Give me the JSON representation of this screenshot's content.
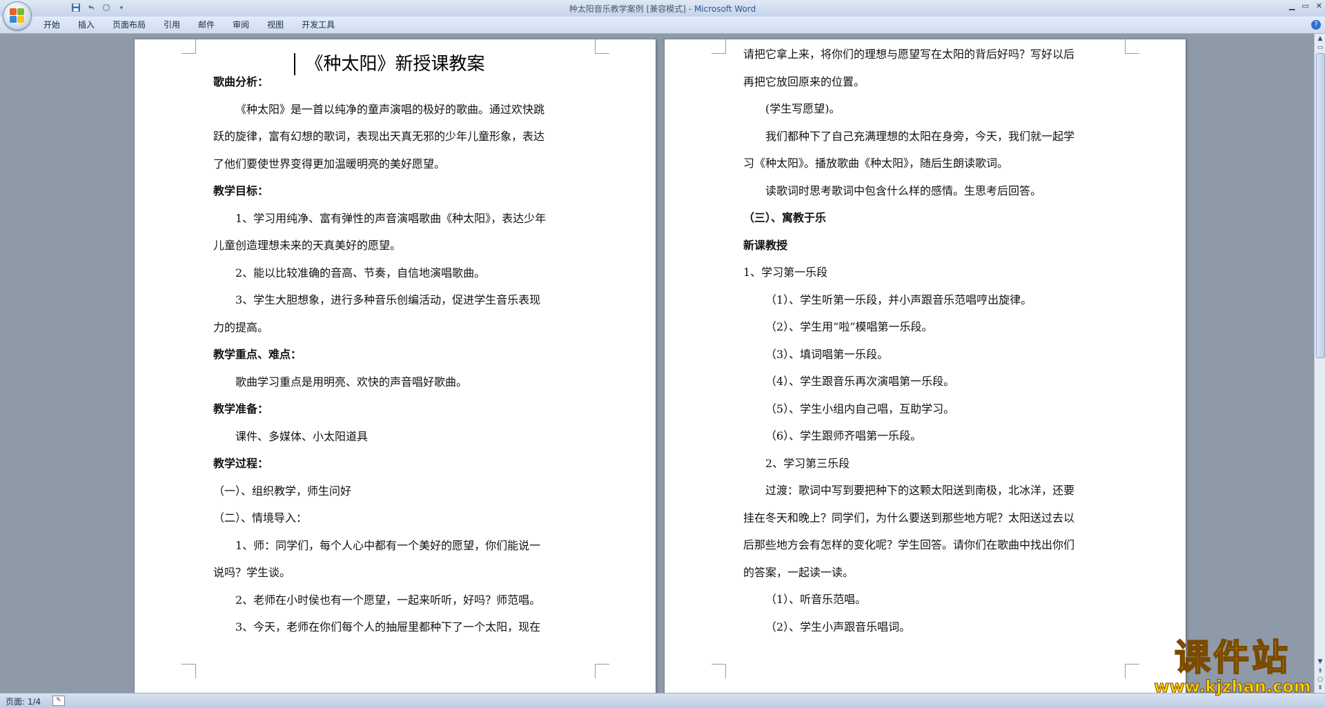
{
  "window": {
    "title": "种太阳音乐教学案例 [兼容模式]",
    "app_name": "Microsoft Word",
    "separator": " - "
  },
  "quick_access": {
    "save_icon": "save-icon",
    "undo_icon": "undo-icon",
    "redo_icon": "redo-icon"
  },
  "ribbon": {
    "tabs": [
      "开始",
      "插入",
      "页面布局",
      "引用",
      "邮件",
      "审阅",
      "视图",
      "开发工具"
    ]
  },
  "left_page": {
    "title": "《种太阳》新授课教案",
    "lines": [
      {
        "text": "歌曲分析：",
        "bold": true
      },
      {
        "text": "《种太阳》是一首以纯净的童声演唱的极好的歌曲。通过欢快跳",
        "indent": true
      },
      {
        "text": "跃的旋律，富有幻想的歌词，表现出天真无邪的少年儿童形象，表达"
      },
      {
        "text": "了他们要使世界变得更加温暖明亮的美好愿望。"
      },
      {
        "text": "教学目标：",
        "bold": true
      },
      {
        "text": "1、学习用纯净、富有弹性的声音演唱歌曲《种太阳》，表达少年",
        "indent": true
      },
      {
        "text": "儿童创造理想未来的天真美好的愿望。"
      },
      {
        "text": "2、能以比较准确的音高、节奏，自信地演唱歌曲。",
        "indent": true
      },
      {
        "text": "3、学生大胆想象，进行多种音乐创编活动，促进学生音乐表现",
        "indent": true
      },
      {
        "text": "力的提高。"
      },
      {
        "text": "教学重点、难点：",
        "bold": true
      },
      {
        "text": "歌曲学习重点是用明亮、欢快的声音唱好歌曲。",
        "indent": true
      },
      {
        "text": "教学准备：",
        "bold": true
      },
      {
        "text": "课件、多媒体、小太阳道具",
        "indent": true
      },
      {
        "text": "教学过程：",
        "bold": true
      },
      {
        "text": "（一）、组织教学，师生问好"
      },
      {
        "text": "（二）、情境导入："
      },
      {
        "text": "1、师：同学们，每个人心中都有一个美好的愿望，你们能说一",
        "indent": true
      },
      {
        "text": "说吗？学生谈。"
      },
      {
        "text": "2、老师在小时侯也有一个愿望，一起来听听，好吗？师范唱。",
        "indent": true
      },
      {
        "text": "3、今天，老师在你们每个人的抽屉里都种下了一个太阳，现在",
        "indent": true
      }
    ]
  },
  "right_page": {
    "lines": [
      {
        "text": "请把它拿上来，将你们的理想与愿望写在太阳的背后好吗？写好以后"
      },
      {
        "text": "再把它放回原来的位置。"
      },
      {
        "text": "(学生写愿望)。",
        "indent": true
      },
      {
        "text": "我们都种下了自己充满理想的太阳在身旁，今天，我们就一起学",
        "indent": true
      },
      {
        "text": "习《种太阳》。播放歌曲《种太阳》，随后生朗读歌词。"
      },
      {
        "text": "读歌词时思考歌词中包含什么样的感情。生思考后回答。",
        "indent": true
      },
      {
        "text": "（三）、寓教于乐",
        "bold": true
      },
      {
        "text": "新课教授",
        "bold": true
      },
      {
        "text": "1、学习第一乐段"
      },
      {
        "text": "（1）、学生听第一乐段，并小声跟音乐范唱哼出旋律。",
        "indent": true
      },
      {
        "text": "（2）、学生用“啦”模唱第一乐段。",
        "indent": true
      },
      {
        "text": "（3）、填词唱第一乐段。",
        "indent": true
      },
      {
        "text": "（4）、学生跟音乐再次演唱第一乐段。",
        "indent": true
      },
      {
        "text": "（5）、学生小组内自己唱，互助学习。",
        "indent": true
      },
      {
        "text": "（6）、学生跟师齐唱第一乐段。",
        "indent": true
      },
      {
        "text": "2、学习第三乐段",
        "indent": true
      },
      {
        "text": "过渡：歌词中写到要把种下的这颗太阳送到南极，北冰洋，还要",
        "indent": true
      },
      {
        "text": "挂在冬天和晚上？同学们，为什么要送到那些地方呢？太阳送过去以"
      },
      {
        "text": "后那些地方会有怎样的变化呢？学生回答。请你们在歌曲中找出你们"
      },
      {
        "text": "的答案，一起读一读。"
      },
      {
        "text": "（1）、听音乐范唱。",
        "indent": true
      },
      {
        "text": "（2）、学生小声跟音乐唱词。",
        "indent": true
      }
    ]
  },
  "status_bar": {
    "page_label": "页面: 1/4"
  },
  "watermark": {
    "main": "课件站",
    "url": "www.kjzhan.com"
  },
  "colors": {
    "title_app": "#2b5797",
    "watermark_fill": "#ffd400",
    "watermark_stroke": "#7a4a00",
    "workspace_bg": "#8e9aa8"
  }
}
